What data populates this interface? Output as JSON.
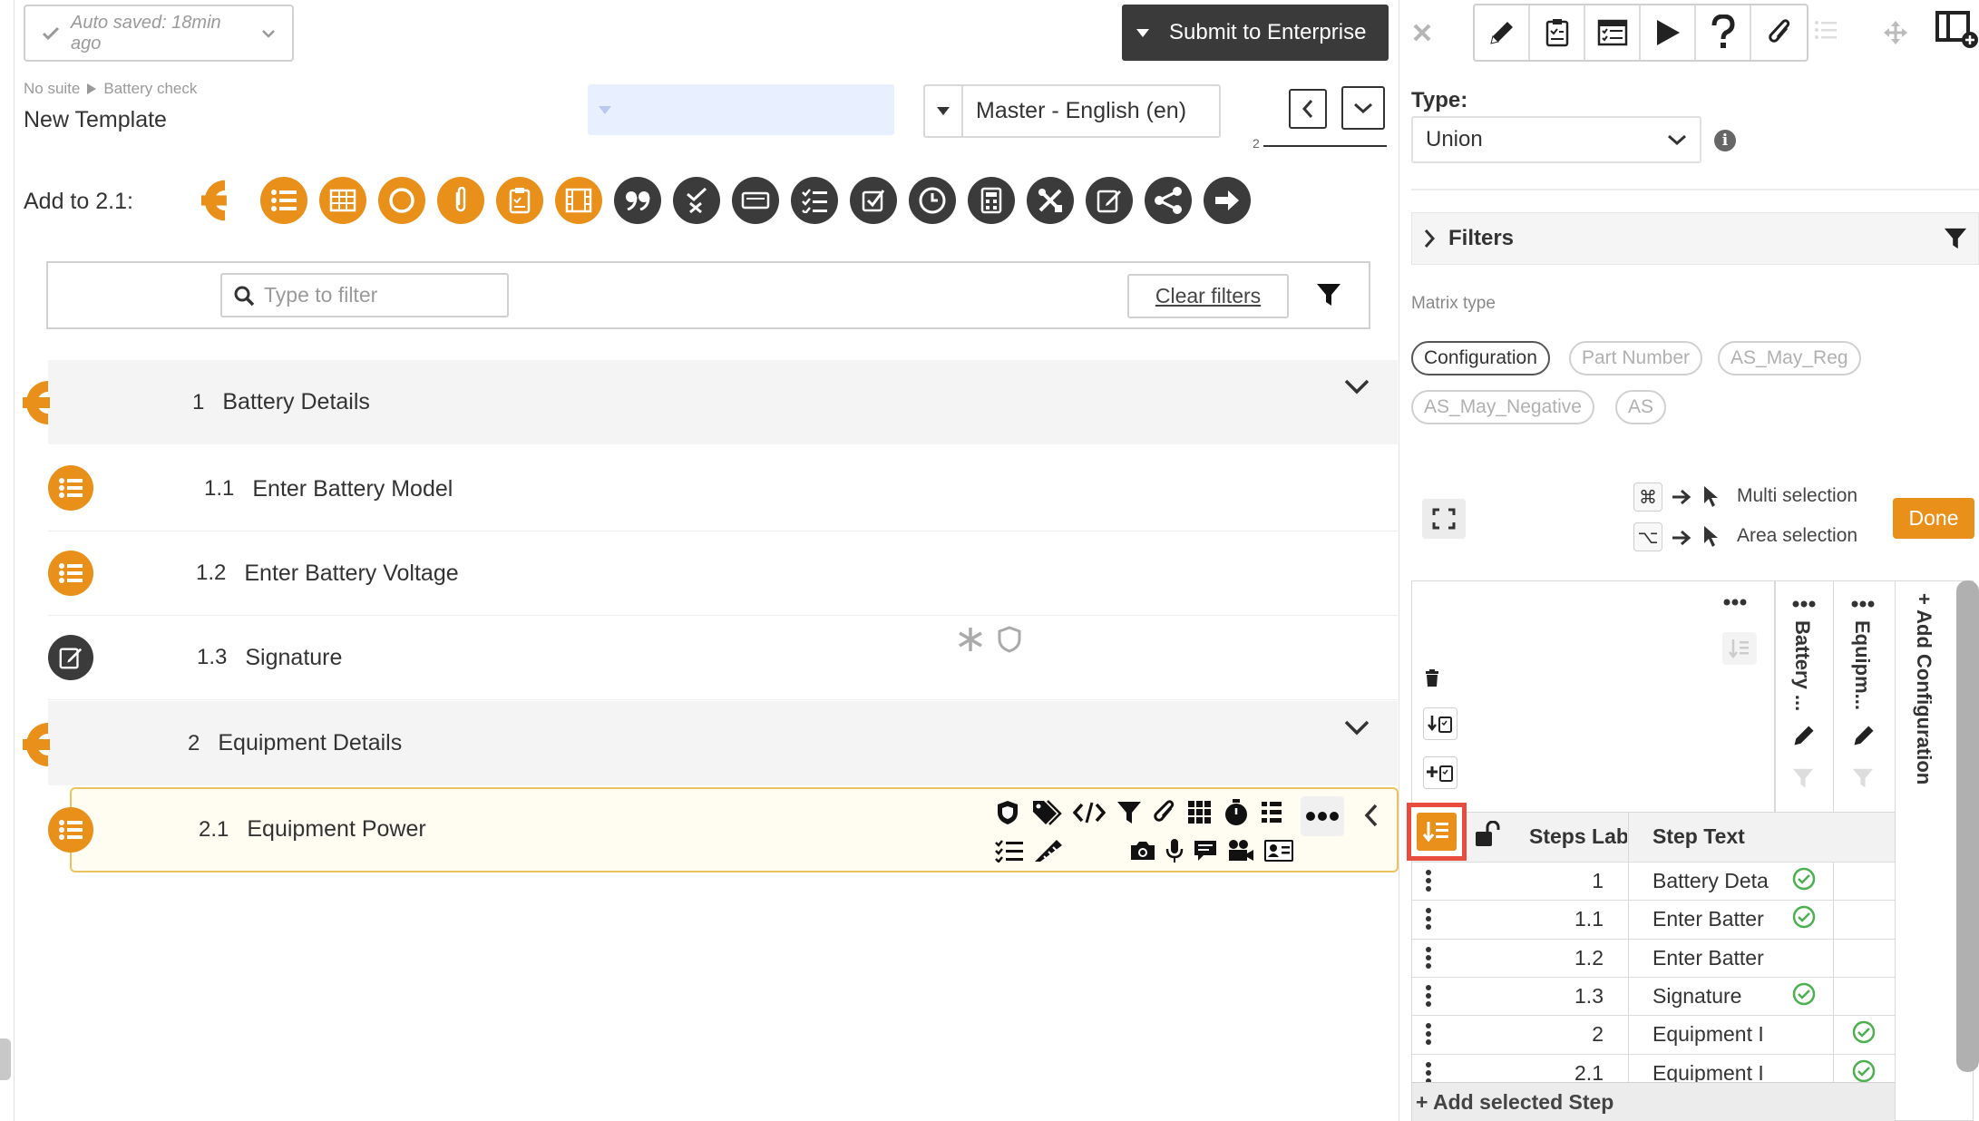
{
  "header": {
    "autosave_text": "Auto saved: 18min ago",
    "submit_label": "Submit to Enterprise",
    "breadcrumb_suite": "No suite",
    "breadcrumb_template": "Battery check",
    "template_name": "New Template",
    "language_select": "Master - English (en)",
    "page_number": "2"
  },
  "add_to": {
    "label": "Add to 2.1:",
    "step_type_icons": [
      "section-icon",
      "list-icon",
      "table-icon",
      "circle-icon",
      "attachment-icon",
      "checklist-icon",
      "media-icon",
      "quote-icon",
      "pass-fail-icon",
      "input-box-icon",
      "multi-check-icon",
      "checkbox-icon",
      "clock-icon",
      "calculator-icon",
      "tools-icon",
      "signature-icon",
      "branch-icon",
      "next-arrow-icon"
    ]
  },
  "filterbar": {
    "search_placeholder": "Type to filter",
    "clear_label": "Clear filters"
  },
  "steps": [
    {
      "num": "1",
      "label": "Battery Details",
      "kind": "section"
    },
    {
      "num": "1.1",
      "label": "Enter Battery Model",
      "kind": "list"
    },
    {
      "num": "1.2",
      "label": "Enter Battery Voltage",
      "kind": "list"
    },
    {
      "num": "1.3",
      "label": "Signature",
      "kind": "signature"
    },
    {
      "num": "2",
      "label": "Equipment Details",
      "kind": "section"
    },
    {
      "num": "2.1",
      "label": "Equipment Power",
      "kind": "list"
    }
  ],
  "right": {
    "type_label": "Type:",
    "type_value": "Union",
    "filters_label": "Filters",
    "matrix_type_label": "Matrix type",
    "matrix_types": [
      "Configuration",
      "Part Number",
      "AS_May_Reg",
      "AS_May_Negative",
      "AS"
    ],
    "selected_matrix_type": "Configuration",
    "multi_selection_label": "Multi selection",
    "area_selection_label": "Area selection",
    "multi_key": "⌘",
    "area_key": "⌥",
    "done_label": "Done",
    "matrix": {
      "col_battery": "Battery ...",
      "col_equipment": "Equipm...",
      "add_configuration": "+ Add Configuration",
      "header_steps_label": "Steps Lab",
      "header_step_text": "Step Text",
      "rows": [
        {
          "label": "1",
          "text": "Battery Deta",
          "battery": true,
          "equipment": false
        },
        {
          "label": "1.1",
          "text": "Enter Batter",
          "battery": true,
          "equipment": false
        },
        {
          "label": "1.2",
          "text": "Enter Batter",
          "battery": false,
          "equipment": false
        },
        {
          "label": "1.3",
          "text": "Signature",
          "battery": true,
          "equipment": false
        },
        {
          "label": "2",
          "text": "Equipment I",
          "battery": false,
          "equipment": true
        },
        {
          "label": "2.1",
          "text": "Equipment I",
          "battery": false,
          "equipment": true
        }
      ],
      "add_selected_step": "+ Add selected Step"
    }
  },
  "colors": {
    "accent_orange": "#e8901a",
    "dark": "#3b3b3b",
    "check_green": "#4caf50",
    "highlight_red": "#e74c3c"
  }
}
